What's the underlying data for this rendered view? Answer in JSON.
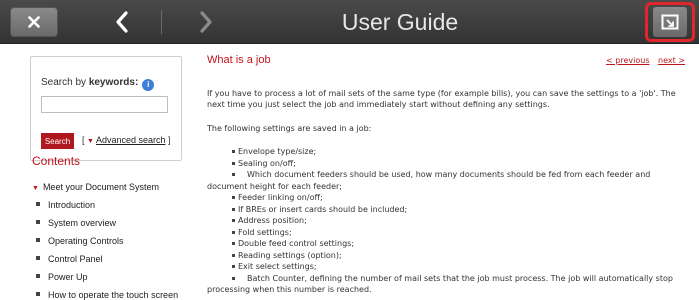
{
  "topbar": {
    "close_icon": "close-x-icon",
    "back_icon": "chevron-left-icon",
    "forward_icon": "chevron-right-icon",
    "title": "User Guide",
    "detach_icon": "open-external-window-icon",
    "highlight_color": "#e0262b"
  },
  "sidebar": {
    "search_label_prefix": "Search by ",
    "search_label_bold": "keywords:",
    "search_input_value": "",
    "search_button_label": "Search",
    "advanced_search_open": "[",
    "advanced_search_link": "Advanced search",
    "advanced_search_close": "]",
    "contents_title": "Contents",
    "toc": [
      {
        "label": "Meet your Document System"
      },
      {
        "label": "Introduction"
      },
      {
        "label": "System overview"
      },
      {
        "label": "Operating Controls"
      },
      {
        "label": "Control Panel"
      },
      {
        "label": "Power Up"
      },
      {
        "label": "How to operate the touch screen"
      }
    ]
  },
  "main": {
    "heading": "What is a job",
    "prev_link": "< previous",
    "next_link": "next >",
    "intro": "If you have to process a lot of mail sets of the same type (for example bills), you can save the settings to a 'job'. The next time you just select the job and immediately start without defining any settings.",
    "settings_intro": "The following settings are saved in a job:",
    "settings": [
      "Envelope type/size;",
      "Sealing on/off;",
      "Which document feeders should be used, how many documents should be fed from each feeder and document height for each feeder;",
      "Feeder linking on/off;",
      "If BREs or insert cards should be included;",
      "Address position;",
      "Fold settings;",
      "Double feed control settings;",
      "Reading settings (option);",
      "Exit select settings;",
      "Batch Counter, defining the number of mail sets that the job must process. The job will automatically stop processing when this number is reached."
    ]
  },
  "colors": {
    "accent_red": "#c0151c",
    "topbar_bg": "#3a3a3a",
    "info_blue": "#3d7fd6"
  }
}
